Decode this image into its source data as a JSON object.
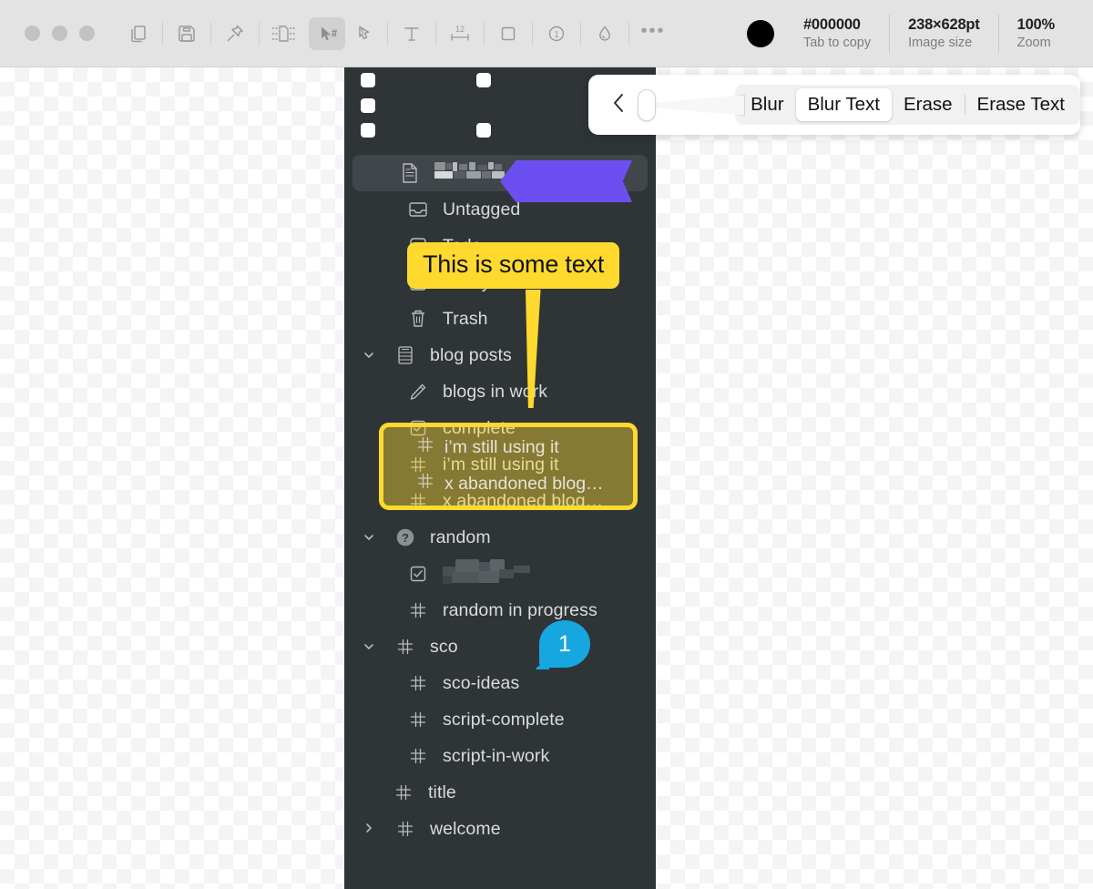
{
  "window": {
    "traffic_lights": [
      "close",
      "minimize",
      "zoom"
    ]
  },
  "toolbar": {
    "tools": [
      {
        "name": "copy",
        "icon": "copy-icon",
        "selected": false
      },
      {
        "name": "save",
        "icon": "save-icon",
        "selected": false
      },
      {
        "name": "pin",
        "icon": "pin-icon",
        "selected": false
      },
      {
        "name": "crop",
        "icon": "crop-icon",
        "selected": false
      },
      {
        "name": "select",
        "icon": "cursor-hash-icon",
        "selected": true
      },
      {
        "name": "highlight",
        "icon": "hand-arrow-icon",
        "selected": false
      },
      {
        "name": "text",
        "icon": "text-icon",
        "selected": false
      },
      {
        "name": "measure",
        "icon": "measure-12-icon",
        "selected": false
      },
      {
        "name": "rectangle",
        "icon": "square-icon",
        "selected": false
      },
      {
        "name": "counter",
        "icon": "counter-1-icon",
        "selected": false
      },
      {
        "name": "blur",
        "icon": "droplet-icon",
        "selected": false
      },
      {
        "name": "more",
        "icon": "ellipsis-icon",
        "selected": false
      }
    ],
    "more_label": "•••",
    "status": {
      "color_value": "#000000",
      "color_label": "Tab to copy",
      "size_value": "238×628pt",
      "size_label": "Image size",
      "zoom_value": "100%",
      "zoom_label": "Zoom"
    }
  },
  "popover": {
    "back_icon": "chevron-left-icon",
    "slider": {
      "name": "intensity-slider",
      "value": 0
    },
    "segments": [
      {
        "label": "Blur",
        "active": false
      },
      {
        "label": "Blur Text",
        "active": true
      },
      {
        "label": "Erase",
        "active": false
      },
      {
        "label": "Erase Text",
        "active": false
      }
    ]
  },
  "screenshot": {
    "selected_row": {
      "icon": "document-icon",
      "label_redacted": true
    },
    "rows": [
      {
        "label": "Untagged",
        "icon": "inbox-icon",
        "indent": 1,
        "chevron": ""
      },
      {
        "label": "Todo",
        "icon": "checkbox-icon",
        "indent": 1,
        "chevron": ""
      },
      {
        "label": "Today",
        "icon": "calendar-icon",
        "indent": 1,
        "chevron": ""
      },
      {
        "label": "Trash",
        "icon": "trash-icon",
        "indent": 1,
        "chevron": ""
      },
      {
        "label": "blog posts",
        "icon": "list-icon",
        "indent": 0,
        "chevron": "down"
      },
      {
        "label": "blogs in work",
        "icon": "pencil-icon",
        "indent": 1,
        "chevron": ""
      },
      {
        "label": "complete",
        "icon": "checkbox-checked-icon",
        "indent": 1,
        "chevron": ""
      },
      {
        "label": "i’m still using it",
        "icon": "hash-icon",
        "indent": 1,
        "chevron": "",
        "highlighted": true
      },
      {
        "label": "x abandoned blog…",
        "icon": "hash-icon",
        "indent": 1,
        "chevron": "",
        "highlighted": true
      },
      {
        "label": "random",
        "icon": "question-icon",
        "indent": 0,
        "chevron": "down"
      },
      {
        "label": "",
        "icon": "checkbox-checked-icon",
        "indent": 1,
        "chevron": "",
        "redacted": true
      },
      {
        "label": "random in progress",
        "icon": "hash-icon",
        "indent": 1,
        "chevron": ""
      },
      {
        "label": "sco",
        "icon": "hash-icon",
        "indent": 0,
        "chevron": "down"
      },
      {
        "label": "sco-ideas",
        "icon": "hash-icon",
        "indent": 1,
        "chevron": ""
      },
      {
        "label": "script-complete",
        "icon": "hash-icon",
        "indent": 1,
        "chevron": ""
      },
      {
        "label": "script-in-work",
        "icon": "hash-icon",
        "indent": 1,
        "chevron": ""
      },
      {
        "label": "title",
        "icon": "hash-icon",
        "indent": 0.5,
        "chevron": ""
      },
      {
        "label": "welcome",
        "icon": "hash-icon",
        "indent": 0.5,
        "chevron": "right"
      }
    ]
  },
  "annotations": {
    "callout_text": "This is some text",
    "callout_color": "#ffd92e",
    "arrow_color": "#6c4ff0",
    "highlight_color": "#ffd92e",
    "badge_number": "1",
    "badge_color": "#17a7e0"
  }
}
